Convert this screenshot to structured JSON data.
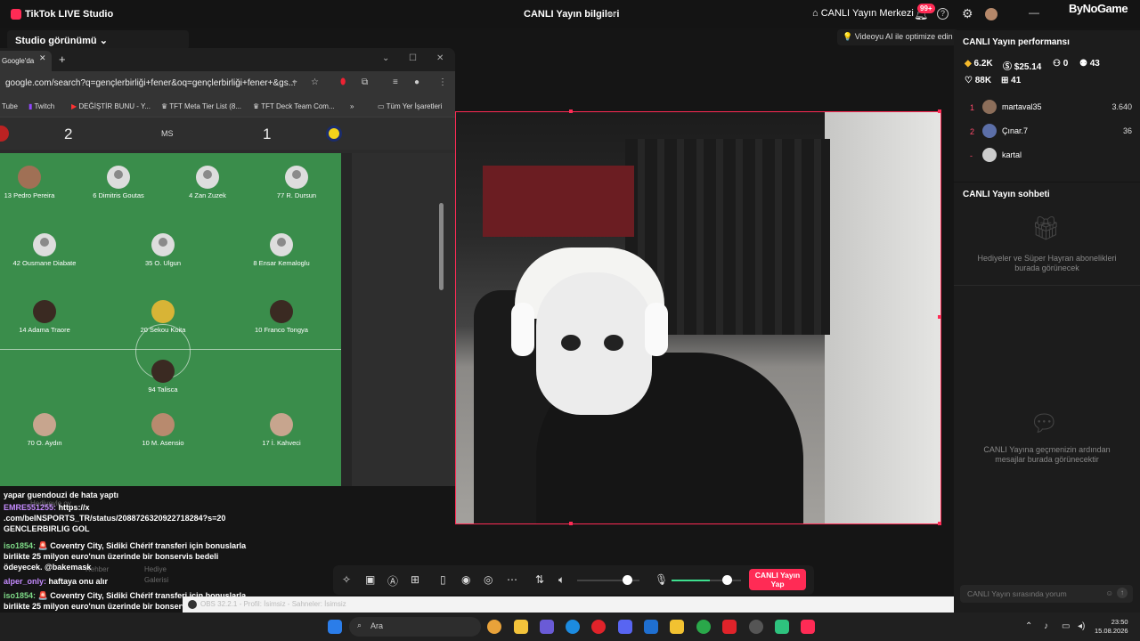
{
  "titlebar": {
    "app_title": "TikTok LIVE Studio",
    "center_title": "CANLI Yayın bilgileri",
    "live_center": "CANLI Yayın Merkezi",
    "notif_badge": "99+",
    "brand": "ByNoGame"
  },
  "studio": {
    "view_label": "Studio görünümü ⌄",
    "tip": "Videoyu AI ile optimize edin"
  },
  "browser": {
    "tab_label": "Google'da",
    "url": "google.com/search?q=gençlerbirliği+fener&oq=gençlerbirliği+fener+&gs...",
    "bookmarks": [
      "Tube",
      "Twitch",
      "DEĞİŞTİR BUNU - Y...",
      "TFT Meta Tier List (8...",
      "TFT Deck Team Com...",
      "»",
      "Tüm Yer İşaretleri"
    ],
    "score_home": "2",
    "score_status": "MS",
    "score_away": "1"
  },
  "lineup": [
    {
      "name": "13 Pedro Pereira"
    },
    {
      "name": "6 Dimitris Goutas"
    },
    {
      "name": "4 Zan Zuzek"
    },
    {
      "name": "77 R. Dursun"
    },
    {
      "name": "42 Ousmane Diabate"
    },
    {
      "name": "35 O. Ulgun"
    },
    {
      "name": "8 Ensar Kemaloglu"
    },
    {
      "name": "14 Adama Traore"
    },
    {
      "name": "20 Sekou Koita"
    },
    {
      "name": "10 Franco Tongya"
    },
    {
      "name": "94 Talisca"
    },
    {
      "name": "70 O. Aydın"
    },
    {
      "name": "10 M. Asensio"
    },
    {
      "name": "17 İ. Kahveci"
    }
  ],
  "chat": [
    {
      "user": "",
      "text": "yapar guendouzi de hata yaptı"
    },
    {
      "user": "EMRE551255:",
      "text": "https://x .com/beINSPORTS_TR/status/2088726320922718284?s=20"
    },
    {
      "user": "",
      "text": "GENCLERBIRLIG GOL"
    },
    {
      "user": "iso1854:",
      "text": "🚨 Coventry City, Sidiki Chérif transferi için bonuslarla birlikte 25 milyon euro'nun üzerinde bir bonservis bedeli ödeyecek. @bakemask"
    },
    {
      "user": "alper_only:",
      "text": "haftaya onu alır"
    },
    {
      "user": "iso1854:",
      "text": "🚨 Coventry City, Sidiki Chérif transferi için bonuslarla birlikte 25 milyon euro'nun üzerinde bir bonservis bedeli ödeyecek. @bakemask kar la sattık abi"
    }
  ],
  "chat_faded": {
    "a": "Hediyeyle oy",
    "b": "Rehber",
    "c": "Hediye Galerisi"
  },
  "controls": {
    "go_live": "CANLI Yayın Yap",
    "volume_level": 0.8,
    "mic_level": 0.55
  },
  "obs": {
    "text": "OBS 32.2.1 - Profil: İsimsiz - Sahneler: İsimsiz"
  },
  "performance": {
    "title": "CANLI Yayın performansı",
    "diamonds": "6.2K",
    "earnings": "$25.14",
    "viewers": "0",
    "new_followers": "43",
    "likes": "88K",
    "gifts": "41",
    "ranking": [
      {
        "rank": "1",
        "name": "martaval35",
        "score": "3.640"
      },
      {
        "rank": "2",
        "name": "Çınar.7",
        "score": "36"
      },
      {
        "rank": "-",
        "name": "kartal",
        "score": ""
      }
    ]
  },
  "live_chat": {
    "title": "CANLI Yayın sohbeti",
    "gifts_empty": "Hediyeler ve Süper Hayran abonelikleri burada görünecek",
    "messages_empty": "CANLI Yayına geçmenizin ardından mesajlar burada görünecektir",
    "input_placeholder": "CANLI Yayın sırasında yorum"
  },
  "taskbar": {
    "search": "Ara",
    "time": "23:50",
    "date": "15.08.2026"
  }
}
